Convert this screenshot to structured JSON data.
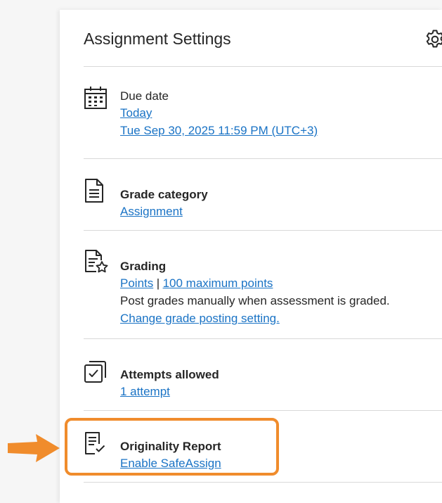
{
  "panel": {
    "title": "Assignment Settings",
    "settings_icon": "gear-icon"
  },
  "due_date": {
    "icon": "calendar-icon",
    "label": "Due date",
    "day_link": "Today",
    "datetime_link": "Tue Sep 30, 2025 11:59 PM (UTC+3)"
  },
  "grade_category": {
    "icon": "document-icon",
    "label": "Grade category",
    "value_link": "Assignment"
  },
  "grading": {
    "icon": "grading-star-icon",
    "label": "Grading",
    "type_link": "Points",
    "separator": "|",
    "max_link": "100 maximum points",
    "posting_text": "Post grades manually when assessment is graded.",
    "posting_link": "Change grade posting setting."
  },
  "attempts": {
    "icon": "attempts-checkbox-icon",
    "label": "Attempts allowed",
    "value_link": "1 attempt"
  },
  "originality": {
    "icon": "report-check-icon",
    "label": "Originality Report",
    "action_link": "Enable SafeAssign"
  },
  "colors": {
    "link": "#1a73c5",
    "highlight": "#f08c2c",
    "divider": "#d9d9d9"
  }
}
